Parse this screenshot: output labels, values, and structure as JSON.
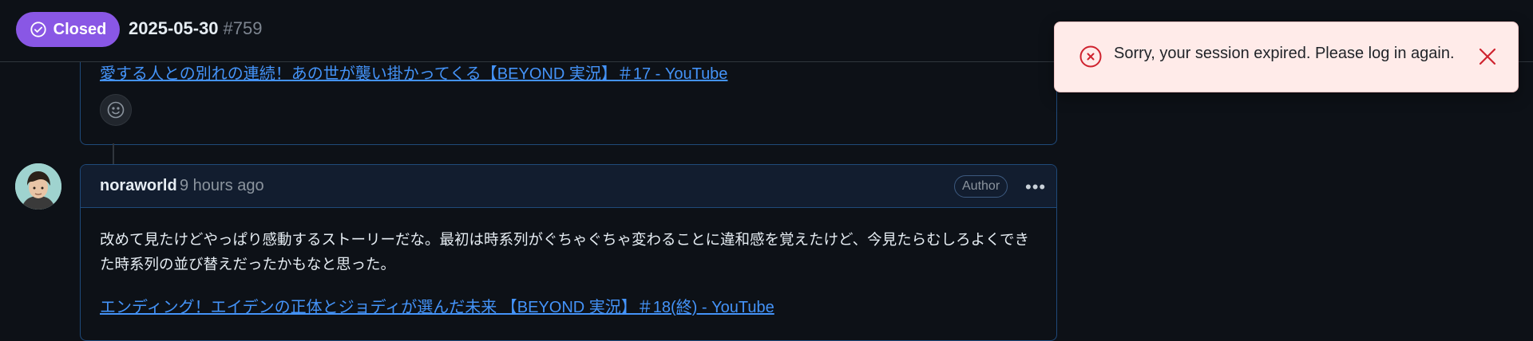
{
  "header": {
    "state_label": "Closed",
    "title": "2025-05-30",
    "number": "#759"
  },
  "previous_comment": {
    "link_text": "愛する人との別れの連続！あの世が襲い掛かってくる【BEYOND 実況】＃17 - YouTube"
  },
  "comment": {
    "author": "noraworld",
    "time": "9 hours ago",
    "author_badge": "Author",
    "body": "改めて見たけどやっぱり感動するストーリーだな。最初は時系列がぐちゃぐちゃ変わることに違和感を覚えたけど、今見たらむしろよくできた時系列の並び替えだったかもなと思った。",
    "link_text": "エンディング！エイデンの正体とジョディが選んだ未来 【BEYOND 実況】＃18(終) - YouTube"
  },
  "toast": {
    "message": "Sorry, your session expired. Please log in again."
  },
  "colors": {
    "closed_badge": "#8957e5",
    "link": "#4493f8",
    "toast_bg": "#ffebe9",
    "toast_icon": "#cf222e"
  },
  "icons": [
    "check-circle-icon",
    "smiley-icon",
    "kebab-horizontal-icon",
    "x-circle-icon",
    "close-icon"
  ]
}
